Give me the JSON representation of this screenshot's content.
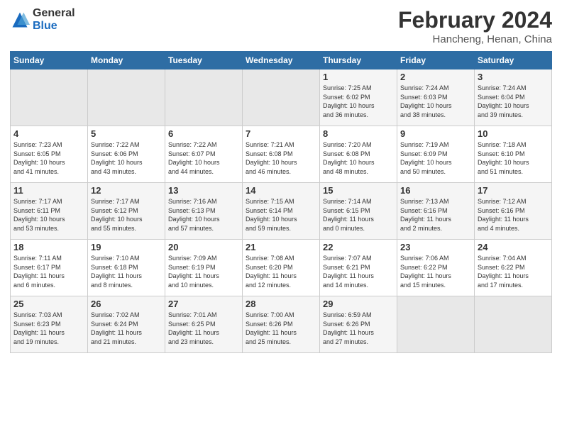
{
  "header": {
    "logo_general": "General",
    "logo_blue": "Blue",
    "main_title": "February 2024",
    "subtitle": "Hancheng, Henan, China"
  },
  "days_of_week": [
    "Sunday",
    "Monday",
    "Tuesday",
    "Wednesday",
    "Thursday",
    "Friday",
    "Saturday"
  ],
  "weeks": [
    [
      {
        "day": "",
        "info": ""
      },
      {
        "day": "",
        "info": ""
      },
      {
        "day": "",
        "info": ""
      },
      {
        "day": "",
        "info": ""
      },
      {
        "day": "1",
        "info": "Sunrise: 7:25 AM\nSunset: 6:02 PM\nDaylight: 10 hours\nand 36 minutes."
      },
      {
        "day": "2",
        "info": "Sunrise: 7:24 AM\nSunset: 6:03 PM\nDaylight: 10 hours\nand 38 minutes."
      },
      {
        "day": "3",
        "info": "Sunrise: 7:24 AM\nSunset: 6:04 PM\nDaylight: 10 hours\nand 39 minutes."
      }
    ],
    [
      {
        "day": "4",
        "info": "Sunrise: 7:23 AM\nSunset: 6:05 PM\nDaylight: 10 hours\nand 41 minutes."
      },
      {
        "day": "5",
        "info": "Sunrise: 7:22 AM\nSunset: 6:06 PM\nDaylight: 10 hours\nand 43 minutes."
      },
      {
        "day": "6",
        "info": "Sunrise: 7:22 AM\nSunset: 6:07 PM\nDaylight: 10 hours\nand 44 minutes."
      },
      {
        "day": "7",
        "info": "Sunrise: 7:21 AM\nSunset: 6:08 PM\nDaylight: 10 hours\nand 46 minutes."
      },
      {
        "day": "8",
        "info": "Sunrise: 7:20 AM\nSunset: 6:08 PM\nDaylight: 10 hours\nand 48 minutes."
      },
      {
        "day": "9",
        "info": "Sunrise: 7:19 AM\nSunset: 6:09 PM\nDaylight: 10 hours\nand 50 minutes."
      },
      {
        "day": "10",
        "info": "Sunrise: 7:18 AM\nSunset: 6:10 PM\nDaylight: 10 hours\nand 51 minutes."
      }
    ],
    [
      {
        "day": "11",
        "info": "Sunrise: 7:17 AM\nSunset: 6:11 PM\nDaylight: 10 hours\nand 53 minutes."
      },
      {
        "day": "12",
        "info": "Sunrise: 7:17 AM\nSunset: 6:12 PM\nDaylight: 10 hours\nand 55 minutes."
      },
      {
        "day": "13",
        "info": "Sunrise: 7:16 AM\nSunset: 6:13 PM\nDaylight: 10 hours\nand 57 minutes."
      },
      {
        "day": "14",
        "info": "Sunrise: 7:15 AM\nSunset: 6:14 PM\nDaylight: 10 hours\nand 59 minutes."
      },
      {
        "day": "15",
        "info": "Sunrise: 7:14 AM\nSunset: 6:15 PM\nDaylight: 11 hours\nand 0 minutes."
      },
      {
        "day": "16",
        "info": "Sunrise: 7:13 AM\nSunset: 6:16 PM\nDaylight: 11 hours\nand 2 minutes."
      },
      {
        "day": "17",
        "info": "Sunrise: 7:12 AM\nSunset: 6:16 PM\nDaylight: 11 hours\nand 4 minutes."
      }
    ],
    [
      {
        "day": "18",
        "info": "Sunrise: 7:11 AM\nSunset: 6:17 PM\nDaylight: 11 hours\nand 6 minutes."
      },
      {
        "day": "19",
        "info": "Sunrise: 7:10 AM\nSunset: 6:18 PM\nDaylight: 11 hours\nand 8 minutes."
      },
      {
        "day": "20",
        "info": "Sunrise: 7:09 AM\nSunset: 6:19 PM\nDaylight: 11 hours\nand 10 minutes."
      },
      {
        "day": "21",
        "info": "Sunrise: 7:08 AM\nSunset: 6:20 PM\nDaylight: 11 hours\nand 12 minutes."
      },
      {
        "day": "22",
        "info": "Sunrise: 7:07 AM\nSunset: 6:21 PM\nDaylight: 11 hours\nand 14 minutes."
      },
      {
        "day": "23",
        "info": "Sunrise: 7:06 AM\nSunset: 6:22 PM\nDaylight: 11 hours\nand 15 minutes."
      },
      {
        "day": "24",
        "info": "Sunrise: 7:04 AM\nSunset: 6:22 PM\nDaylight: 11 hours\nand 17 minutes."
      }
    ],
    [
      {
        "day": "25",
        "info": "Sunrise: 7:03 AM\nSunset: 6:23 PM\nDaylight: 11 hours\nand 19 minutes."
      },
      {
        "day": "26",
        "info": "Sunrise: 7:02 AM\nSunset: 6:24 PM\nDaylight: 11 hours\nand 21 minutes."
      },
      {
        "day": "27",
        "info": "Sunrise: 7:01 AM\nSunset: 6:25 PM\nDaylight: 11 hours\nand 23 minutes."
      },
      {
        "day": "28",
        "info": "Sunrise: 7:00 AM\nSunset: 6:26 PM\nDaylight: 11 hours\nand 25 minutes."
      },
      {
        "day": "29",
        "info": "Sunrise: 6:59 AM\nSunset: 6:26 PM\nDaylight: 11 hours\nand 27 minutes."
      },
      {
        "day": "",
        "info": ""
      },
      {
        "day": "",
        "info": ""
      }
    ]
  ]
}
